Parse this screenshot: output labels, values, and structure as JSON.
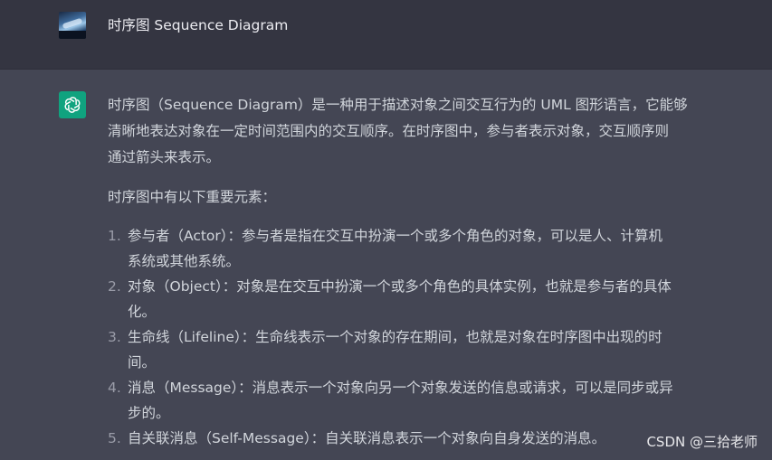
{
  "user_message": {
    "avatar": "user-photo-avatar",
    "text": "时序图 Sequence Diagram"
  },
  "assistant_message": {
    "avatar": "openai-logo-icon",
    "avatar_color": "#10a37f",
    "paragraph1": "时序图（Sequence Diagram）是一种用于描述对象之间交互行为的 UML 图形语言，它能够\n清晰地表达对象在一定时间范围内的交互顺序。在时序图中，参与者表示对象，交互顺序则\n通过箭头来表示。",
    "paragraph2": "时序图中有以下重要元素：",
    "items": [
      {
        "number": "1.",
        "text": "参与者（Actor）：参与者是指在交互中扮演一个或多个角色的对象，可以是人、计算机\n系统或其他系统。"
      },
      {
        "number": "2.",
        "text": "对象（Object）：对象是在交互中扮演一个或多个角色的具体实例，也就是参与者的具体\n化。"
      },
      {
        "number": "3.",
        "text": "生命线（Lifeline）：生命线表示一个对象的存在期间，也就是对象在时序图中出现的时\n间。"
      },
      {
        "number": "4.",
        "text": "消息（Message）：消息表示一个对象向另一个对象发送的信息或请求，可以是同步或异\n步的。"
      },
      {
        "number": "5.",
        "text": "自关联消息（Self-Message）：自关联消息表示一个对象向自身发送的消息。"
      }
    ]
  },
  "watermark": "CSDN @三拾老师",
  "colors": {
    "user_row_bg": "#343541",
    "assistant_row_bg": "#444654",
    "text": "#d1d5db"
  }
}
